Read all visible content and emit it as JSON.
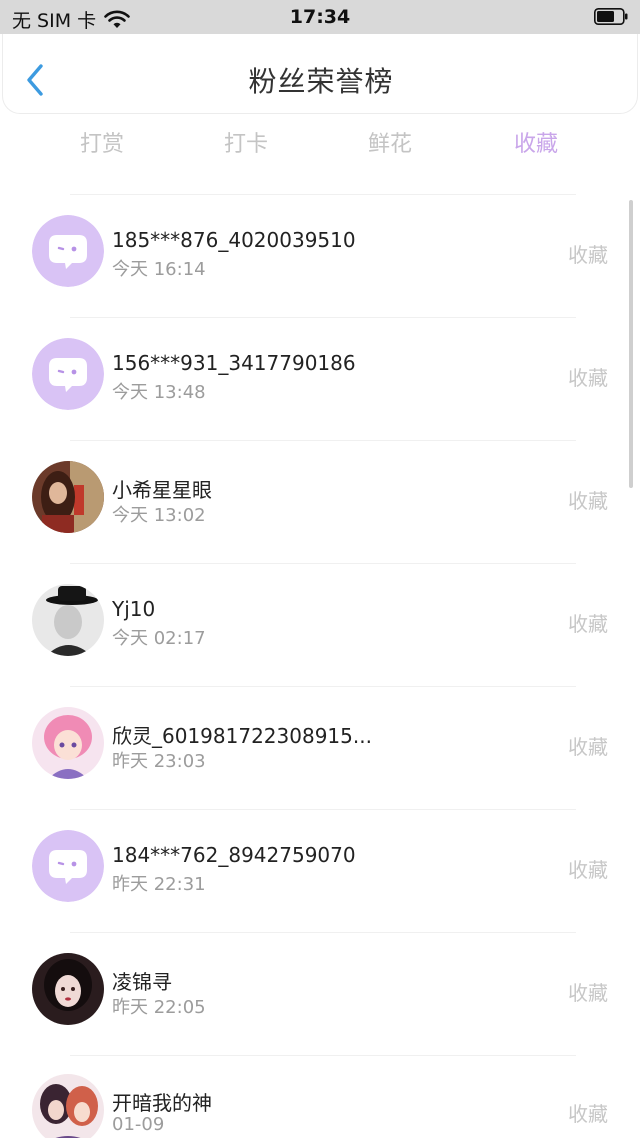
{
  "status": {
    "carrier": "无 SIM 卡",
    "time": "17:34"
  },
  "header": {
    "title": "粉丝荣誉榜"
  },
  "tabs": [
    {
      "label": "打赏"
    },
    {
      "label": "打卡"
    },
    {
      "label": "鲜花"
    },
    {
      "label": "收藏"
    }
  ],
  "active_tab": "收藏",
  "rows": [
    {
      "name": "185***876_4020039510",
      "time": "今天 16:14",
      "action": "收藏",
      "avatar": "default-chat-avatar"
    },
    {
      "name": "156***931_3417790186",
      "time": "今天 13:48",
      "action": "收藏",
      "avatar": "default-chat-avatar"
    },
    {
      "name": "小希星星眼",
      "time": "今天 13:02",
      "action": "收藏",
      "avatar": "photo-avatar"
    },
    {
      "name": "Yj10",
      "time": "今天 02:17",
      "action": "收藏",
      "avatar": "photo-avatar"
    },
    {
      "name": "欣灵_601981722308915...",
      "time": "昨天 23:03",
      "action": "收藏",
      "avatar": "photo-avatar"
    },
    {
      "name": "184***762_8942759070",
      "time": "昨天 22:31",
      "action": "收藏",
      "avatar": "default-chat-avatar"
    },
    {
      "name": "凌锦寻",
      "time": "昨天 22:05",
      "action": "收藏",
      "avatar": "photo-avatar"
    },
    {
      "name": "开暗我的神",
      "time": "01-09",
      "action": "收藏",
      "avatar": "photo-avatar"
    }
  ],
  "colors": {
    "accent": "#c9a6ea",
    "avatar_default_bg": "#d9c3f5",
    "status_bar_bg": "#d9d9d9",
    "back_arrow": "#3d9be0"
  }
}
